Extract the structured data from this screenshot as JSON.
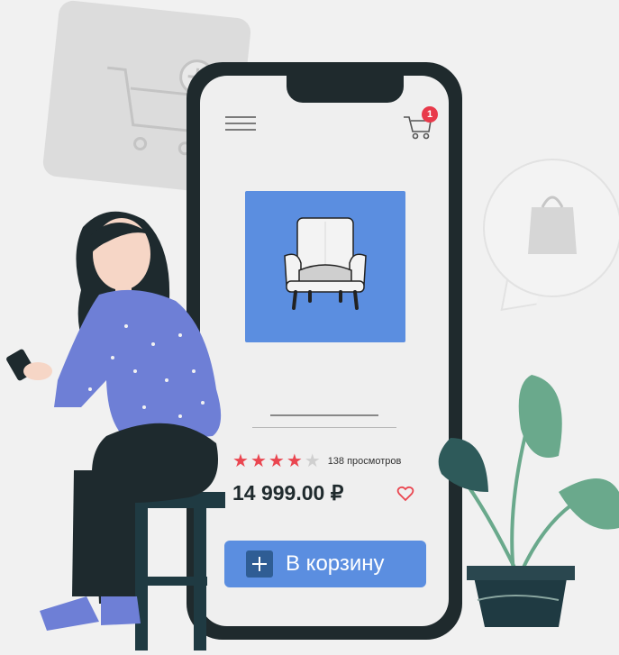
{
  "cart": {
    "badge_count": "1"
  },
  "product": {
    "rating_stars": 4,
    "rating_max": 5,
    "views": "138 просмотров",
    "price": "14 999.00 ₽"
  },
  "actions": {
    "add_to_cart_label": "В корзину"
  },
  "colors": {
    "accent_blue": "#5b8ee0",
    "star_red": "#ea4650",
    "badge_red": "#e8394a",
    "phone_dark": "#1f2a2d",
    "shirt_purple": "#6e7fd6",
    "plant_green": "#6aa98c"
  },
  "icons": {
    "menu": "hamburger-menu-icon",
    "cart": "shopping-cart-icon",
    "heart": "heart-outline-icon",
    "plus": "plus-icon"
  }
}
